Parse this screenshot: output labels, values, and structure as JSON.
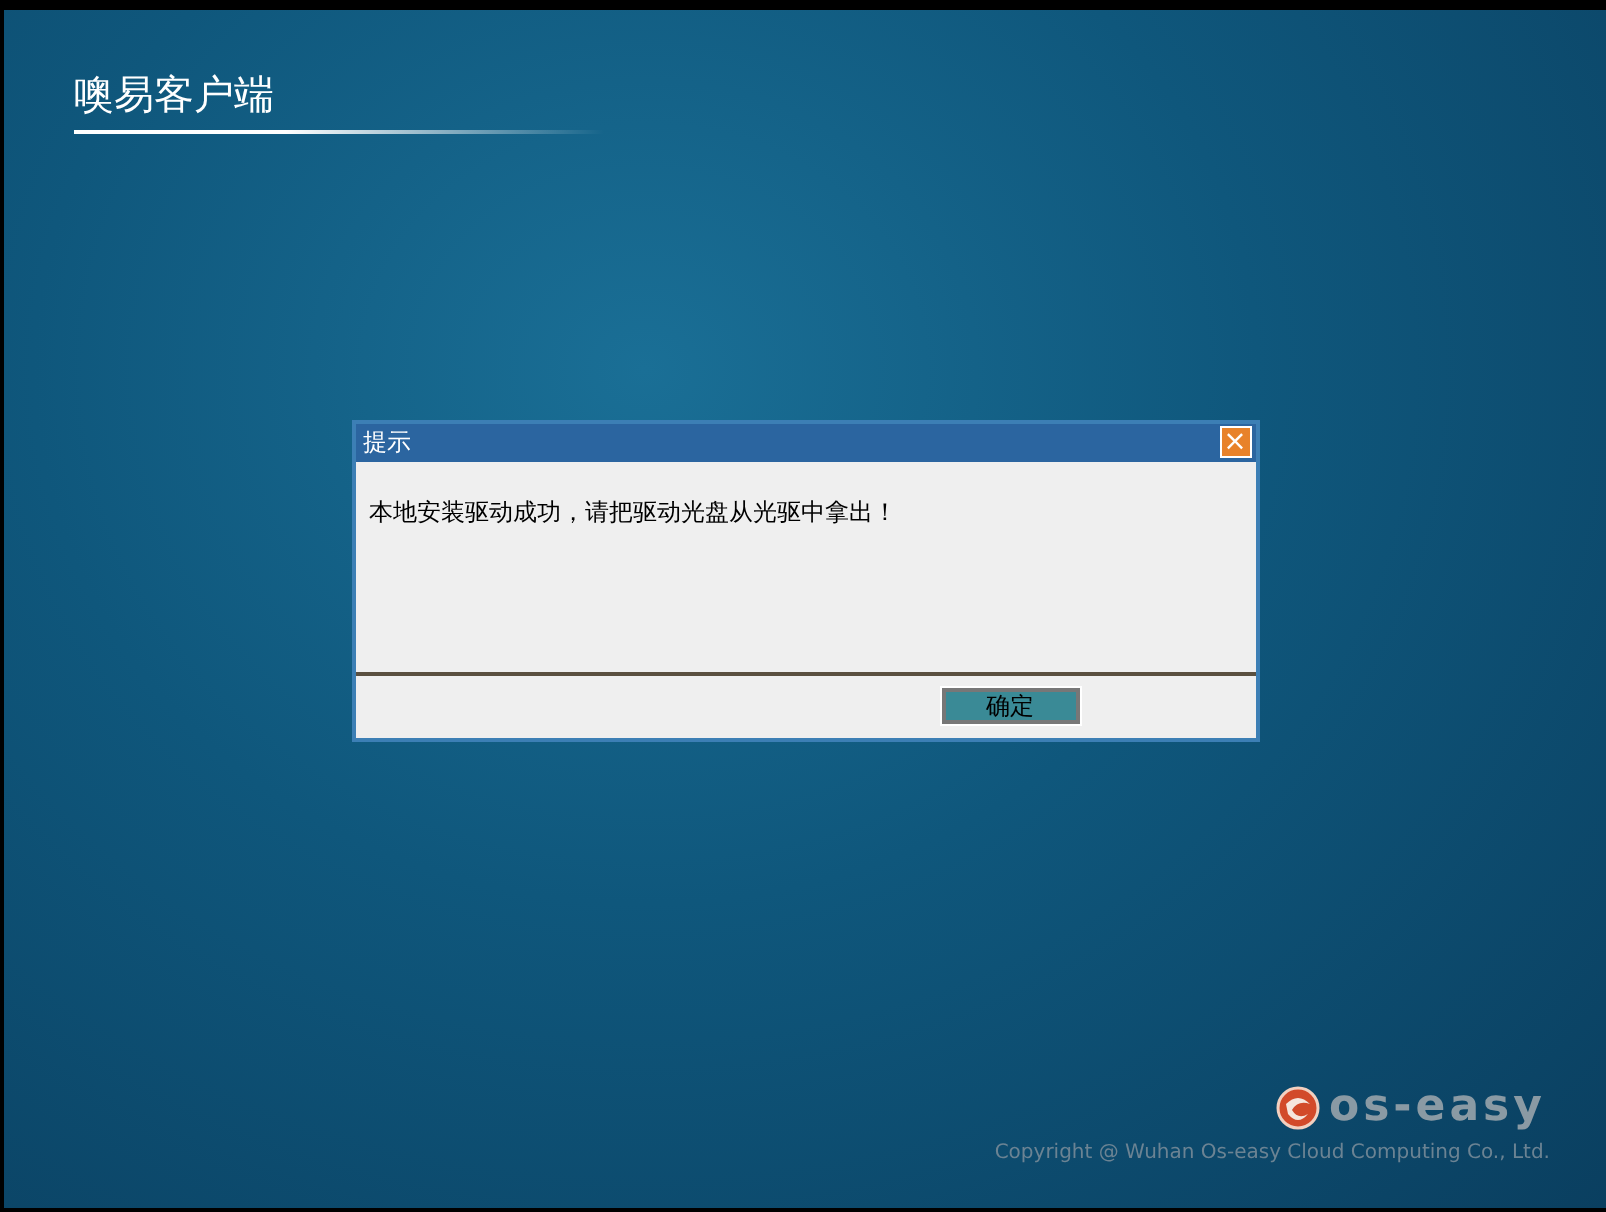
{
  "app_title": "噢易客户端",
  "dialog": {
    "title": "提示",
    "close": "×",
    "message": "本地安装驱动成功，请把驱动光盘从光驱中拿出！",
    "buttons": [
      "确定"
    ]
  },
  "brand": {
    "name": "os-easy",
    "copyright": "Copyright @ Wuhan Os-easy Cloud Computing Co., Ltd."
  }
}
